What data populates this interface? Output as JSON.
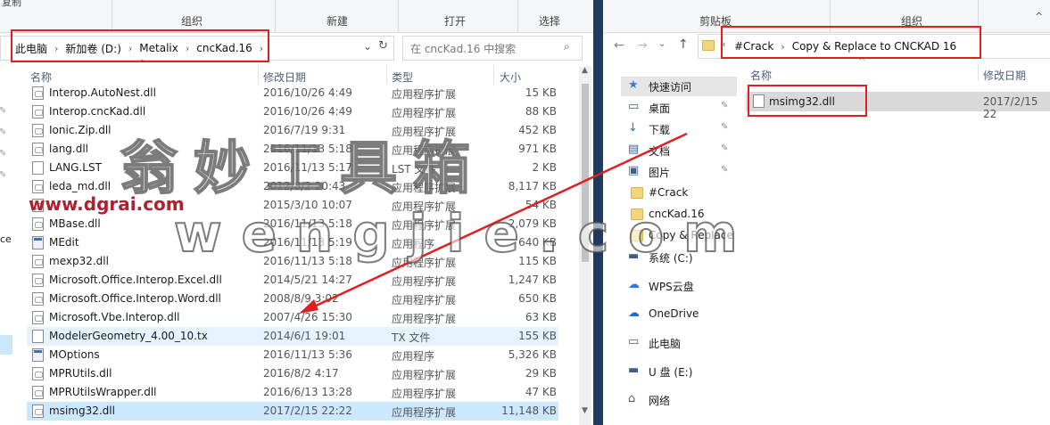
{
  "left_window": {
    "ribbon": {
      "top_labels": [
        "复制",
        "打开",
        "剪贴板"
      ],
      "groups": [
        "组织",
        "新建",
        "打开",
        "选择"
      ]
    },
    "breadcrumb": [
      "此电脑",
      "新加卷 (D:)",
      "Metalix",
      "cncKad.16"
    ],
    "search_placeholder": "在 cncKad.16 中搜索",
    "columns": {
      "name": "名称",
      "date": "修改日期",
      "type": "类型",
      "size": "大小"
    },
    "nav_partial_label": "ce",
    "files": [
      {
        "name": "Interop.AutoNest.dll",
        "date": "2016/10/26 4:49",
        "type": "应用程序扩展",
        "size": "15 KB",
        "icon": "dll"
      },
      {
        "name": "Interop.cncKad.dll",
        "date": "2016/10/26 4:49",
        "type": "应用程序扩展",
        "size": "88 KB",
        "icon": "dll"
      },
      {
        "name": "Ionic.Zip.dll",
        "date": "2016/7/19 9:31",
        "type": "应用程序扩展",
        "size": "452 KB",
        "icon": "dll"
      },
      {
        "name": "lang.dll",
        "date": "2016/11/13 5:18",
        "type": "应用程序扩展",
        "size": "971 KB",
        "icon": "dll"
      },
      {
        "name": "LANG.LST",
        "date": "2016/11/13 5:17",
        "type": "LST 文件",
        "size": "2 KB",
        "icon": "file"
      },
      {
        "name": "leda_md.dll",
        "date": "2012/8/2 20:43",
        "type": "应用程序扩展",
        "size": "8,117 KB",
        "icon": "dll"
      },
      {
        "name": "",
        "date": "2015/3/10 10:07",
        "type": "应用程序扩展",
        "size": "54 KB",
        "icon": "dll"
      },
      {
        "name": "MBase.dll",
        "date": "2016/11/13 5:18",
        "type": "应用程序扩展",
        "size": "2,079 KB",
        "icon": "dll"
      },
      {
        "name": "MEdit",
        "date": "2016/11/13 5:19",
        "type": "应用程序",
        "size": "640 KB",
        "icon": "exe"
      },
      {
        "name": "mexp32.dll",
        "date": "2016/11/13 5:18",
        "type": "应用程序扩展",
        "size": "115 KB",
        "icon": "dll"
      },
      {
        "name": "Microsoft.Office.Interop.Excel.dll",
        "date": "2014/5/21 14:27",
        "type": "应用程序扩展",
        "size": "1,247 KB",
        "icon": "dll"
      },
      {
        "name": "Microsoft.Office.Interop.Word.dll",
        "date": "2008/8/9 3:02",
        "type": "应用程序扩展",
        "size": "650 KB",
        "icon": "dll"
      },
      {
        "name": "Microsoft.Vbe.Interop.dll",
        "date": "2007/4/26 15:30",
        "type": "应用程序扩展",
        "size": "63 KB",
        "icon": "dll"
      },
      {
        "name": "ModelerGeometry_4.00_10.tx",
        "date": "2014/6/1 19:01",
        "type": "TX 文件",
        "size": "155 KB",
        "icon": "file"
      },
      {
        "name": "MOptions",
        "date": "2016/11/13 5:36",
        "type": "应用程序",
        "size": "5,326 KB",
        "icon": "exe"
      },
      {
        "name": "MPRUtils.dll",
        "date": "2016/8/2 4:17",
        "type": "应用程序扩展",
        "size": "29 KB",
        "icon": "dll"
      },
      {
        "name": "MPRUtilsWrapper.dll",
        "date": "2016/6/13 13:28",
        "type": "应用程序扩展",
        "size": "47 KB",
        "icon": "dll"
      },
      {
        "name": "msimg32.dll",
        "date": "2017/2/15 22:22",
        "type": "应用程序扩展",
        "size": "11,148 KB",
        "icon": "dll"
      }
    ]
  },
  "right_window": {
    "ribbon": {
      "top_label": "剪贴板",
      "groups": [
        "剪贴板",
        "组织"
      ]
    },
    "breadcrumb": [
      "#Crack",
      "Copy & Replace to CNCKAD 16"
    ],
    "columns": {
      "name": "名称",
      "date": "修改日期"
    },
    "nav": [
      {
        "label": "快速访问",
        "icon": "star-icon"
      },
      {
        "label": "桌面",
        "icon": "desktop-icon",
        "pinned": true
      },
      {
        "label": "下载",
        "icon": "download-icon",
        "pinned": true
      },
      {
        "label": "文档",
        "icon": "document-icon",
        "pinned": true
      },
      {
        "label": "图片",
        "icon": "picture-icon",
        "pinned": true
      },
      {
        "label": "#Crack",
        "icon": "folder-icon"
      },
      {
        "label": "cncKad.16",
        "icon": "folder-icon"
      },
      {
        "label": "Copy & Replace",
        "icon": "folder-icon"
      },
      {
        "label": "系统 (C:)",
        "icon": "drive-icon"
      },
      {
        "label": "WPS云盘",
        "icon": "cloud-icon"
      },
      {
        "label": "OneDrive",
        "icon": "onedrive-icon"
      },
      {
        "label": "此电脑",
        "icon": "computer-icon"
      },
      {
        "label": "U 盘 (E:)",
        "icon": "usb-drive-icon"
      },
      {
        "label": "网络",
        "icon": "network-icon"
      }
    ],
    "files": [
      {
        "name": "msimg32.dll",
        "date": "2017/2/15 22"
      }
    ]
  },
  "watermark": {
    "big_cn": "翁妙工具箱",
    "big_en": "wengjie.com",
    "url": "www.dgrai.com"
  },
  "annotations": {
    "color": "#e02020"
  }
}
